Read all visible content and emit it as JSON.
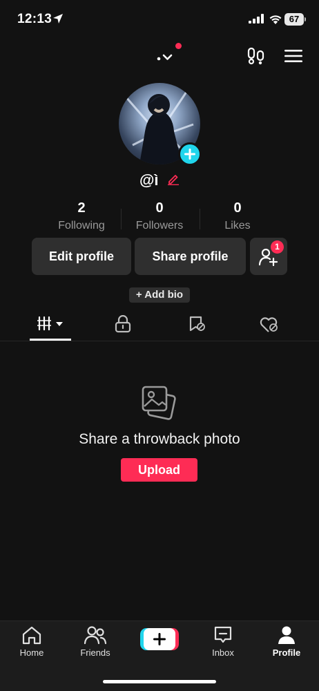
{
  "status_bar": {
    "time": "12:13",
    "battery": "67"
  },
  "profile": {
    "username": "@ì",
    "stats": [
      {
        "value": "2",
        "label": "Following"
      },
      {
        "value": "0",
        "label": "Followers"
      },
      {
        "value": "0",
        "label": "Likes"
      }
    ],
    "edit_profile_label": "Edit profile",
    "share_profile_label": "Share profile",
    "friend_requests_badge": "1",
    "add_bio_label": "+ Add bio"
  },
  "tabs": [
    {
      "icon": "videos-grid-icon",
      "selected": true
    },
    {
      "icon": "lock-icon",
      "selected": false
    },
    {
      "icon": "favorites-icon",
      "selected": false
    },
    {
      "icon": "liked-icon",
      "selected": false
    }
  ],
  "empty_state": {
    "icon": "photos-icon",
    "title": "Share a throwback photo",
    "button_label": "Upload"
  },
  "bottom_nav": {
    "items": [
      {
        "label": "Home",
        "icon": "home-icon"
      },
      {
        "label": "Friends",
        "icon": "friends-icon"
      },
      {
        "label": "",
        "icon": "create-icon"
      },
      {
        "label": "Inbox",
        "icon": "inbox-icon"
      },
      {
        "label": "Profile",
        "icon": "profile-icon"
      }
    ]
  },
  "colors": {
    "background": "#121212",
    "accent_red": "#fe2c55",
    "accent_cyan": "#20d5ec",
    "button_bg": "#2f2f2f",
    "muted_text": "#9a9a9a"
  }
}
